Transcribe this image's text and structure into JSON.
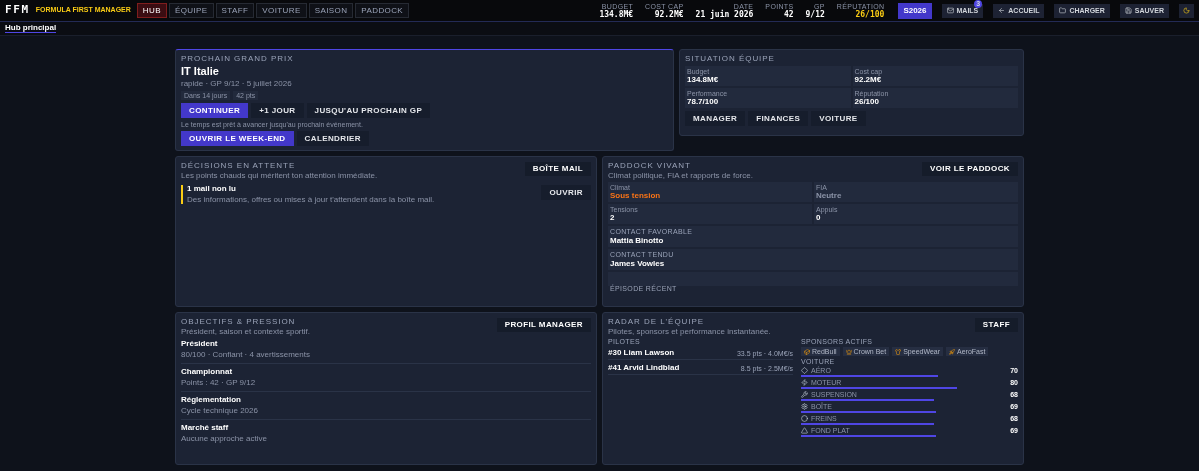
{
  "header": {
    "logo": "FFM",
    "subtitle": "FORMULA FIRST MANAGER",
    "tabs": [
      {
        "label": "HUB",
        "selected": true
      },
      {
        "label": "ÉQUIPE",
        "selected": false
      },
      {
        "label": "STAFF",
        "selected": false
      },
      {
        "label": "VOITURE",
        "selected": false
      },
      {
        "label": "SAISON",
        "selected": false
      },
      {
        "label": "PADDOCK",
        "selected": false
      }
    ],
    "stats": [
      {
        "label": "BUDGET",
        "value": "134.8M€",
        "kind": "plain"
      },
      {
        "label": "COST CAP",
        "value": "92.2M€",
        "kind": "plain"
      },
      {
        "label": "DATE",
        "value": "21 juin 2026",
        "kind": "plain"
      },
      {
        "label": "POINTS",
        "value": "42",
        "kind": "plain"
      },
      {
        "label": "GP",
        "value": "9/12",
        "kind": "plain"
      },
      {
        "label": "RÉPUTATION",
        "value": "26/100",
        "kind": "accent"
      }
    ],
    "season": "S2026",
    "buttons": [
      {
        "label": "MAILS",
        "badge": "3"
      },
      {
        "label": "ACCUEIL"
      },
      {
        "label": "CHARGER"
      },
      {
        "label": "SAUVER"
      }
    ]
  },
  "breadcrumb": "Hub principal",
  "next_gp": {
    "kicker": "PROCHAIN GRAND PRIX",
    "title": "IT Italie",
    "meta": "rapide · GP 9/12 · 5 juillet 2026",
    "chips": [
      "Dans 14 jours",
      "42 pts"
    ],
    "actions": [
      {
        "label": "CONTINUER",
        "primary": true
      },
      {
        "label": "+1 JOUR",
        "primary": false
      },
      {
        "label": "JUSQU'AU PROCHAIN GP",
        "primary": false
      }
    ],
    "note": "Le temps est prêt à avancer jusqu'au prochain événement.",
    "actions2": [
      {
        "label": "OUVRIR LE WEEK-END",
        "primary": true
      },
      {
        "label": "CALENDRIER",
        "primary": false
      }
    ]
  },
  "team": {
    "kicker": "SITUATION ÉQUIPE",
    "tiles": [
      {
        "label": "Budget",
        "value": "134.8M€"
      },
      {
        "label": "Cost cap",
        "value": "92.2M€"
      },
      {
        "label": "Performance",
        "value": "78.7/100"
      },
      {
        "label": "Réputation",
        "value": "26/100"
      }
    ],
    "links": [
      "MANAGER",
      "FINANCES",
      "VOITURE"
    ]
  },
  "decisions": {
    "kicker": "DÉCISIONS EN ATTENTE",
    "desc": "Les points chauds qui méritent ton attention immédiate.",
    "action": "BOÎTE MAIL",
    "items": [
      {
        "title": "1 mail non lu",
        "text": "Des informations, offres ou mises à jour t'attendent dans la boîte mail.",
        "action": "OUVRIR"
      }
    ]
  },
  "paddock": {
    "kicker": "PADDOCK VIVANT",
    "desc": "Climat politique, FIA et rapports de force.",
    "action": "VOIR LE PADDOCK",
    "tiles": [
      {
        "label": "Climat",
        "value": "Sous tension",
        "kind": "warn"
      },
      {
        "label": "FIA",
        "value": "Neutre",
        "kind": "muted"
      },
      {
        "label": "Tensions",
        "value": "2",
        "kind": "plain"
      },
      {
        "label": "Appuis",
        "value": "0",
        "kind": "plain"
      }
    ],
    "contacts": [
      {
        "label": "CONTACT FAVORABLE",
        "value": "Mattia Binotto"
      },
      {
        "label": "CONTACT TENDU",
        "value": "James Vowles"
      }
    ],
    "episode": "ÉPISODE RÉCENT"
  },
  "objectives": {
    "kicker": "OBJECTIFS & PRESSION",
    "desc": "Président, saison et contexte sportif.",
    "action": "PROFIL MANAGER",
    "items": [
      {
        "title": "Président",
        "text": "80/100 · Confiant · 4 avertissements"
      },
      {
        "title": "Championnat",
        "text": "Points : 42 · GP 9/12"
      },
      {
        "title": "Réglementation",
        "text": "Cycle technique 2026"
      },
      {
        "title": "Marché staff",
        "text": "Aucune approche active"
      }
    ]
  },
  "radar": {
    "kicker": "RADAR DE L'ÉQUIPE",
    "desc": "Pilotes, sponsors et performance instantanée.",
    "action": "STAFF",
    "drivers_title": "PILOTES",
    "drivers": [
      {
        "name": "#30 Liam Lawson",
        "info": "33.5 pts · 4.0M€/s"
      },
      {
        "name": "#41 Arvid Lindblad",
        "info": "8.5 pts · 2.5M€/s"
      }
    ],
    "sponsors_title": "SPONSORS ACTIFS",
    "sponsors": [
      {
        "name": "RedBull"
      },
      {
        "name": "Crown Bet"
      },
      {
        "name": "SpeedWear"
      },
      {
        "name": "AeroFast"
      }
    ],
    "car_title": "VOITURE",
    "car": [
      {
        "name": "AÉRO",
        "value": "70",
        "level": 0.7
      },
      {
        "name": "MOTEUR",
        "value": "80",
        "level": 0.8
      },
      {
        "name": "SUSPENSION",
        "value": "68",
        "level": 0.68
      },
      {
        "name": "BOÎTE",
        "value": "69",
        "level": 0.69
      },
      {
        "name": "FREINS",
        "value": "68",
        "level": 0.68
      },
      {
        "name": "FOND PLAT",
        "value": "69",
        "level": 0.69
      }
    ]
  }
}
